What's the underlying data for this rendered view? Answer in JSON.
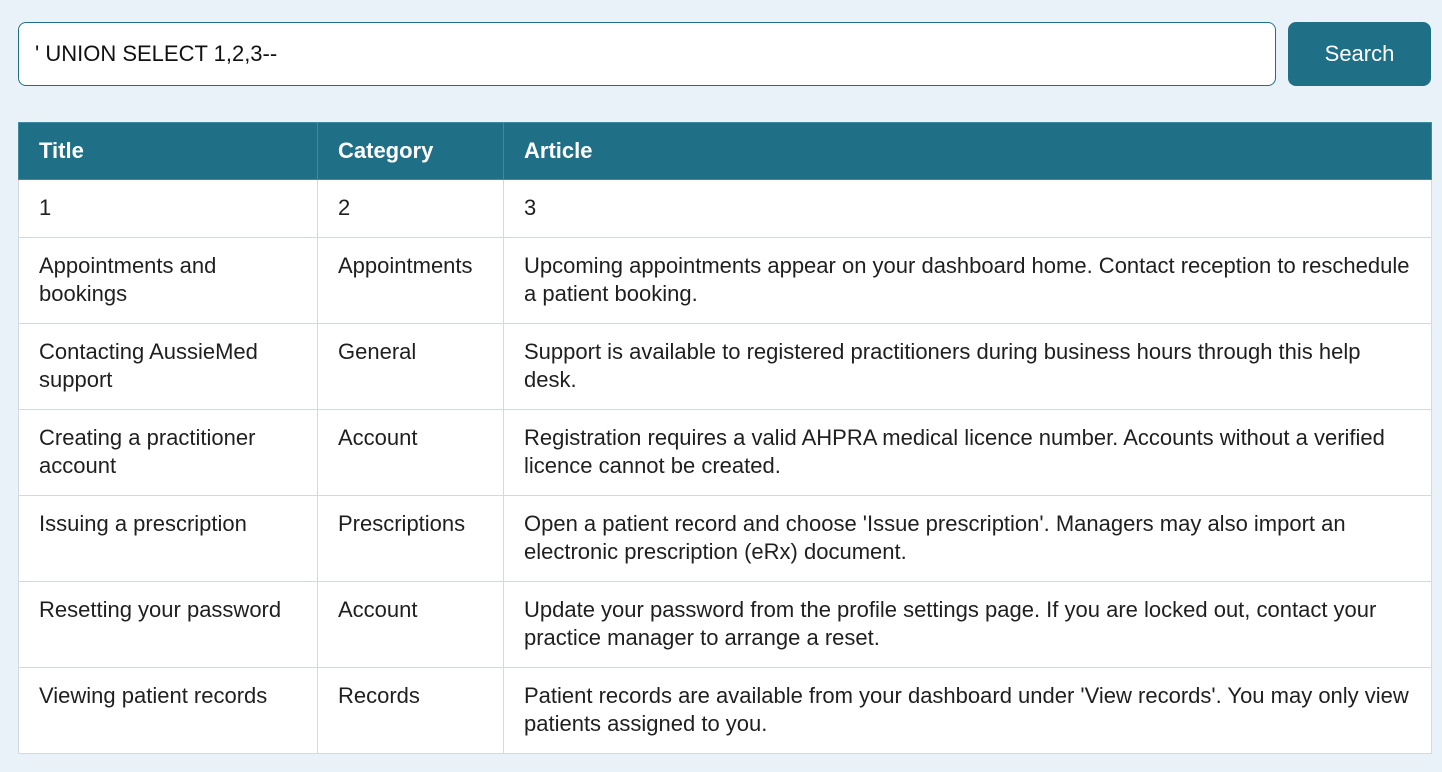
{
  "search": {
    "query": "' UNION SELECT 1,2,3--",
    "button_label": "Search"
  },
  "table": {
    "headers": [
      "Title",
      "Category",
      "Article"
    ],
    "rows": [
      {
        "title": "1",
        "category": "2",
        "article": "3"
      },
      {
        "title": "Appointments and bookings",
        "category": "Appointments",
        "article": "Upcoming appointments appear on your dashboard home. Contact reception to reschedule a patient booking."
      },
      {
        "title": "Contacting AussieMed support",
        "category": "General",
        "article": "Support is available to registered practitioners during business hours through this help desk."
      },
      {
        "title": "Creating a practitioner account",
        "category": "Account",
        "article": "Registration requires a valid AHPRA medical licence number. Accounts without a verified licence cannot be created."
      },
      {
        "title": "Issuing a prescription",
        "category": "Prescriptions",
        "article": "Open a patient record and choose 'Issue prescription'. Managers may also import an electronic prescription (eRx) document."
      },
      {
        "title": "Resetting your password",
        "category": "Account",
        "article": "Update your password from the profile settings page. If you are locked out, contact your practice manager to arrange a reset."
      },
      {
        "title": "Viewing patient records",
        "category": "Records",
        "article": "Patient records are available from your dashboard under 'View records'. You may only view patients assigned to you."
      }
    ]
  },
  "colors": {
    "background": "#eaf2f9",
    "accent": "#1f6f87",
    "header_text": "#ffffff"
  }
}
